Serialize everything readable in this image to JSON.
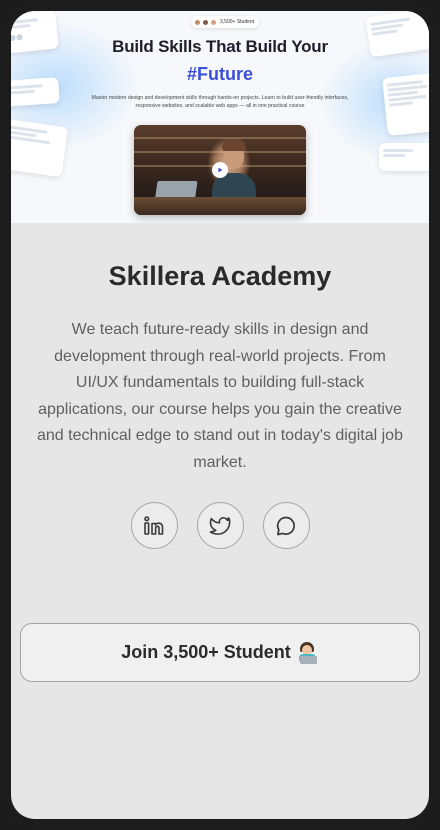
{
  "hero": {
    "students_pill": "3,500+ Student",
    "title": "Build Skills That Build Your",
    "accent": "#Future",
    "subtitle": "Master modern design and development skills through hands-on projects. Learn to build user-friendly interfaces, responsive websites, and scalable web apps — all in one practical course",
    "accent_color": "#3b4fd8",
    "video_play_icon": "play-icon"
  },
  "profile": {
    "name": "Skillera Academy",
    "description": "We teach future-ready skills in design and development through real-world projects. From UI/UX fundamentals to building full-stack applications, our course helps you gain the creative and technical edge to stand out in today's digital job market."
  },
  "socials": [
    {
      "icon": "linkedin-icon"
    },
    {
      "icon": "twitter-icon"
    },
    {
      "icon": "chat-icon"
    }
  ],
  "cta": {
    "label": "Join 3,500+ Student",
    "emoji_icon": "technologist-emoji-icon"
  }
}
